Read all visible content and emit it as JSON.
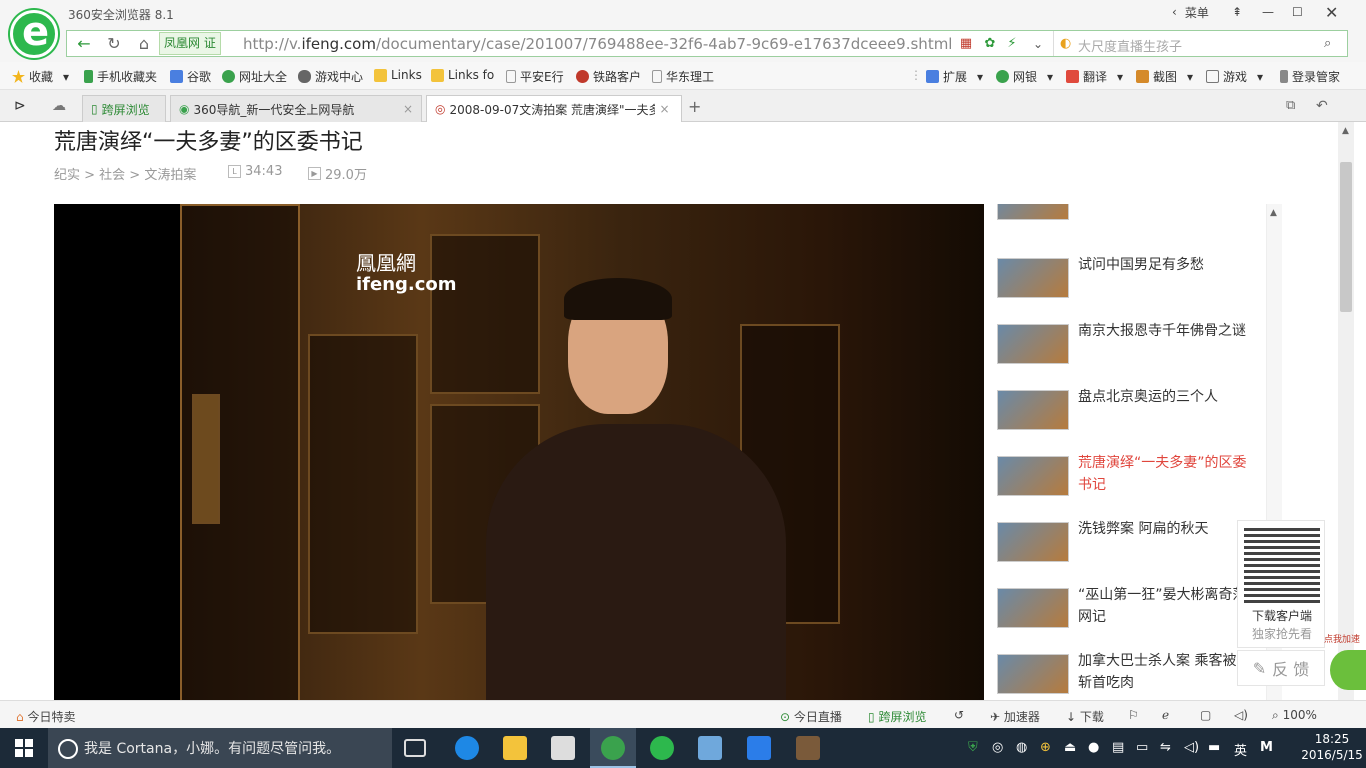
{
  "app": {
    "title": "360安全浏览器 8.1",
    "menu_label": "菜单"
  },
  "addressbar": {
    "site_badge": "凤凰网 证",
    "url_prefix": "http://v.",
    "url_domain": "ifeng.com",
    "url_path": "/documentary/case/201007/769488ee-32f6-4ab7-9c69-e17637dceee9.shtml",
    "search_placeholder": "大尺度直播生孩子"
  },
  "bookmarks": [
    {
      "label": "收藏",
      "icon": "star-icon",
      "color": "#f2b51d"
    },
    {
      "label": "手机收藏夹",
      "icon": "phone-icon",
      "color": "#3aa24d"
    },
    {
      "label": "谷歌",
      "icon": "google-icon",
      "color": "#4a7fe0"
    },
    {
      "label": "网址大全",
      "icon": "globe-icon",
      "color": "#3aa24d"
    },
    {
      "label": "游戏中心",
      "icon": "gamepad-icon",
      "color": "#555"
    },
    {
      "label": "Links",
      "icon": "folder-icon",
      "color": "#f3c33b"
    },
    {
      "label": "Links fo",
      "icon": "folder-icon",
      "color": "#f3c33b"
    },
    {
      "label": "平安E行",
      "icon": "page-icon",
      "color": "#888"
    },
    {
      "label": "铁路客户",
      "icon": "rail-icon",
      "color": "#c0392b"
    },
    {
      "label": "华东理工",
      "icon": "page-icon",
      "color": "#888"
    }
  ],
  "toolbar_right": [
    {
      "label": "扩展"
    },
    {
      "label": "网银"
    },
    {
      "label": "翻译"
    },
    {
      "label": "截图"
    },
    {
      "label": "游戏"
    },
    {
      "label": "登录管家"
    }
  ],
  "tabs": [
    {
      "label": "跨屏浏览"
    },
    {
      "label": "360导航_新一代安全上网导航"
    },
    {
      "label": "2008-09-07文涛拍案 荒唐演绎\"一夫多"
    }
  ],
  "page": {
    "title": "荒唐演绎“一夫多妻”的区委书记",
    "breadcrumb": "纪实 > 社会 > 文涛拍案",
    "duration": "34:43",
    "plays": "29.0万"
  },
  "video": {
    "watermark_cn": "鳳凰網",
    "watermark_en": "ifeng.com"
  },
  "sidebar": [
    {
      "title": "试问中国男足有多愁",
      "active": false
    },
    {
      "title": "南京大报恩寺千年佛骨之谜",
      "active": false
    },
    {
      "title": "盘点北京奥运的三个人",
      "active": false
    },
    {
      "title": "荒唐演绎“一夫多妻”的区委书记",
      "active": true
    },
    {
      "title": "洗钱弊案 阿扁的秋天",
      "active": false
    },
    {
      "title": "“巫山第一狂”晏大彬离奇落网记",
      "active": false
    },
    {
      "title": "加拿大巴士杀人案 乘客被斩首吃肉",
      "active": false
    }
  ],
  "qr": {
    "line1": "下载客户端",
    "line2": "独家抢先看"
  },
  "feedback_label": "反 馈",
  "speedup_label": "点我加速",
  "statusbar": {
    "left": "今日特卖",
    "live": "今日直播",
    "cross": "跨屏浏览",
    "accel": "加速器",
    "download": "下载",
    "zoom": "100%"
  },
  "taskbar": {
    "cortana": "我是 Cortana，小娜。有问题尽管问我。",
    "ime": "英",
    "time": "18:25",
    "date": "2016/5/15"
  }
}
